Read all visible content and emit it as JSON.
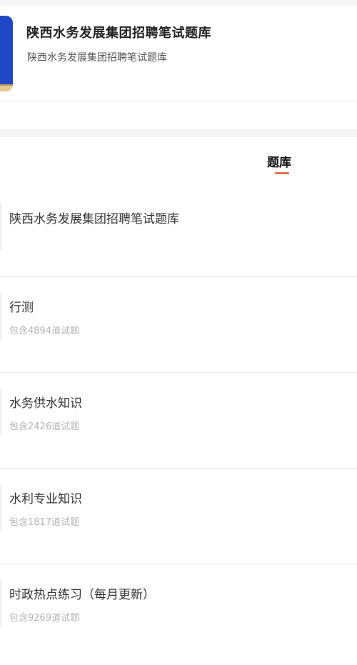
{
  "header": {
    "title": "陕西水务发展集团招聘笔试题库",
    "subtitle": "陕西水务发展集团招聘笔试题库"
  },
  "tabs": {
    "active_label": "题库"
  },
  "list": {
    "items": [
      {
        "name": "陕西水务发展集团招聘笔试题库",
        "count": ""
      },
      {
        "name": "行测",
        "count": "包含4894道试题"
      },
      {
        "name": "水务供水知识",
        "count": "包含2426道试题"
      },
      {
        "name": "水利专业知识",
        "count": "包含1817道试题"
      },
      {
        "name": "时政热点练习（每月更新）",
        "count": "包含9269道试题"
      }
    ]
  },
  "colors": {
    "accent": "#e0724f",
    "cover_blue": "#1f47c6",
    "muted_text": "#b5b5b5"
  }
}
